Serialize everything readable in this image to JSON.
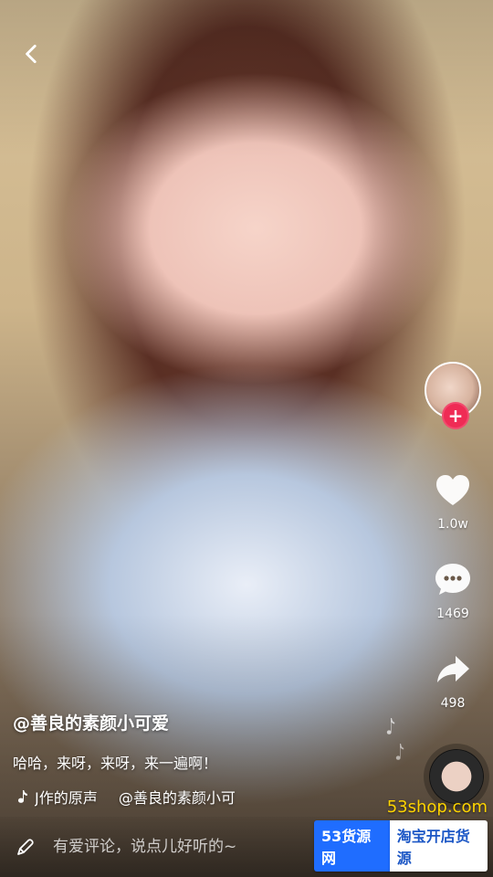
{
  "video": {
    "background_icon": "video-frame"
  },
  "nav": {
    "back_icon": "chevron-left-icon"
  },
  "right_rail": {
    "avatar_icon": "avatar",
    "follow_icon": "plus-icon",
    "follow_label": "+",
    "like": {
      "icon": "heart-icon",
      "count": "1.0w"
    },
    "comment": {
      "icon": "comment-icon",
      "count": "1469"
    },
    "share": {
      "icon": "share-icon",
      "count": "498"
    },
    "music_disc_icon": "music-disc-icon"
  },
  "caption": {
    "author": "@善良的素颜小可爱",
    "text": "哈哈，来呀，来呀，来一遍啊！",
    "music": {
      "icon": "music-note-icon",
      "marquee_part1": "J作的原声",
      "marquee_part2": "@善良的素颜小可"
    }
  },
  "comment_bar": {
    "icon": "pencil-icon",
    "placeholder": "有爱评论，说点儿好听的~"
  },
  "watermark": {
    "url": "53shop.com",
    "left": "53货源网",
    "right": "淘宝开店货源"
  },
  "colors": {
    "accent_red": "#ef2c55",
    "watermark_blue": "#1f6dff",
    "watermark_yellow": "#ffd400"
  }
}
